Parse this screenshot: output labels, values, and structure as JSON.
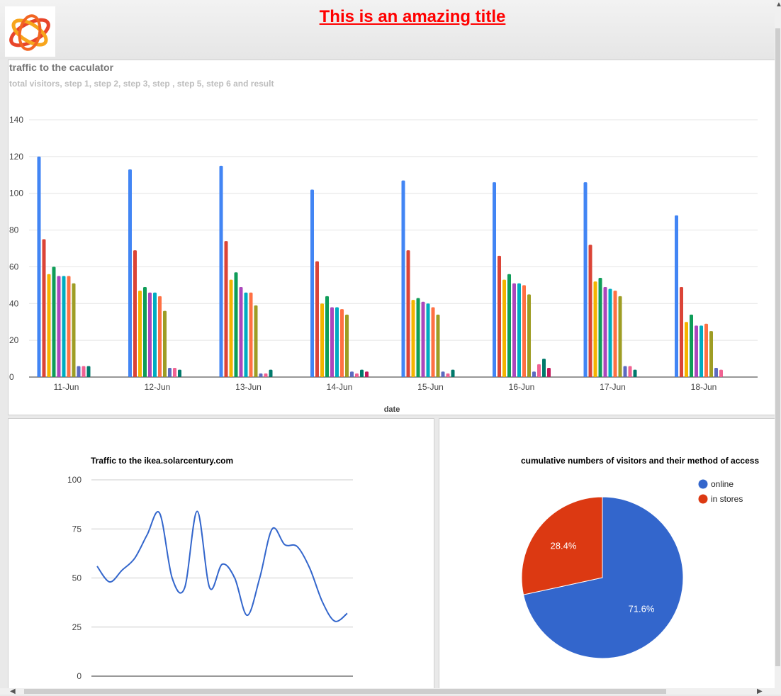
{
  "page": {
    "title": "This is an amazing title"
  },
  "colors": {
    "series": [
      "#4285f4",
      "#db4437",
      "#f4b400",
      "#0f9d58",
      "#ab47bc",
      "#00acc1",
      "#ff7043",
      "#9e9d24",
      "#5c6bc0",
      "#f06292",
      "#00796b",
      "#c2185b"
    ],
    "line": "#3366cc",
    "pie": [
      "#3366cc",
      "#dc3912"
    ],
    "title_red": "#ff0000"
  },
  "icons": {
    "logo": "orbit-logo-icon"
  },
  "chart_data": [
    {
      "type": "bar",
      "title": "traffic to the caculator",
      "subtitle": "total visitors, step 1, step 2, step 3, step , step 5, step 6 and result",
      "xlabel": "date",
      "ylim": [
        0,
        140
      ],
      "yticks": [
        0,
        20,
        40,
        60,
        80,
        100,
        120,
        140
      ],
      "grid": true,
      "categories": [
        "11-Jun",
        "12-Jun",
        "13-Jun",
        "14-Jun",
        "15-Jun",
        "16-Jun",
        "17-Jun",
        "18-Jun"
      ],
      "series": [
        {
          "values": [
            120,
            113,
            115,
            102,
            107,
            106,
            106,
            88
          ]
        },
        {
          "values": [
            75,
            69,
            74,
            63,
            69,
            66,
            72,
            49
          ]
        },
        {
          "values": [
            56,
            47,
            53,
            40,
            42,
            53,
            52,
            30
          ]
        },
        {
          "values": [
            60,
            49,
            57,
            44,
            43,
            56,
            54,
            34
          ]
        },
        {
          "values": [
            55,
            46,
            49,
            38,
            41,
            51,
            49,
            28
          ]
        },
        {
          "values": [
            55,
            46,
            46,
            38,
            40,
            51,
            48,
            28
          ]
        },
        {
          "values": [
            55,
            44,
            46,
            37,
            38,
            50,
            47,
            29
          ]
        },
        {
          "values": [
            51,
            36,
            39,
            34,
            34,
            45,
            44,
            25
          ]
        },
        {
          "values": [
            6,
            5,
            2,
            3,
            3,
            3,
            6,
            5
          ]
        },
        {
          "values": [
            6,
            5,
            2,
            2,
            2,
            7,
            6,
            4
          ]
        },
        {
          "values": [
            6,
            4,
            4,
            4,
            4,
            10,
            4,
            0
          ]
        },
        {
          "values": [
            0,
            0,
            0,
            3,
            0,
            5,
            0,
            0
          ]
        }
      ]
    },
    {
      "type": "line",
      "title": "Traffic to the ikea.solarcentury.com",
      "ylim": [
        0,
        100
      ],
      "yticks": [
        0,
        25,
        50,
        75,
        100
      ],
      "grid": true,
      "values": [
        56,
        48,
        54,
        60,
        72,
        83,
        50,
        45,
        84,
        45,
        57,
        50,
        31,
        50,
        75,
        67,
        66,
        55,
        38,
        28,
        32
      ]
    },
    {
      "type": "pie",
      "title": "cumulative numbers of visitors and their method of access",
      "legend_position": "top-right",
      "slices": [
        {
          "label": "online",
          "value": 71.6,
          "text": "71.6%"
        },
        {
          "label": "in stores",
          "value": 28.4,
          "text": "28.4%"
        }
      ]
    }
  ]
}
